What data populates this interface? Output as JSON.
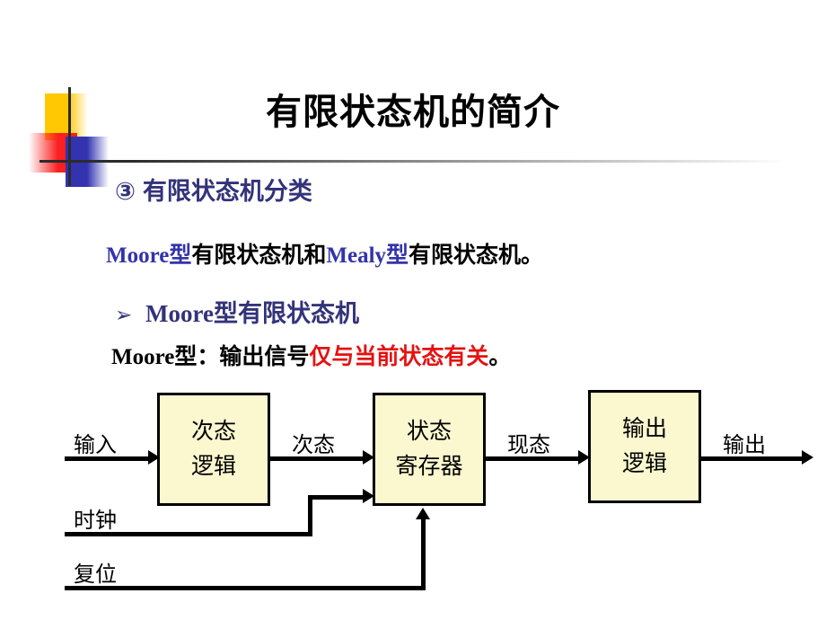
{
  "slide": {
    "title": "有限状态机的简介",
    "section_heading": {
      "marker": "③",
      "text": "有限状态机分类"
    },
    "types_line": {
      "moore": "Moore",
      "moore_suffix": "型",
      "mid": "有限状态机和",
      "mealy": "Mealy",
      "mealy_suffix": "型",
      "tail": "有限状态机。"
    },
    "moore_heading": {
      "bullet": "➢",
      "latin": "Moore",
      "text": "型有限状态机"
    },
    "moore_definition": {
      "latin": "Moore",
      "prefix": "型：输出信号",
      "highlight": "仅与当前状态有关",
      "suffix": "。"
    }
  },
  "diagram": {
    "boxes": [
      {
        "id": "next-logic",
        "line1": "次态",
        "line2": "逻辑"
      },
      {
        "id": "state-reg",
        "line1": "状态",
        "line2": "寄存器"
      },
      {
        "id": "output-logic",
        "line1": "输出",
        "line2": "逻辑"
      }
    ],
    "labels": {
      "input": "输入",
      "next_state": "次态",
      "current_state": "现态",
      "output": "输出",
      "clock": "时钟",
      "reset": "复位"
    }
  },
  "colors": {
    "heading_navy": "#33337a",
    "accent_blue": "#3333aa",
    "accent_red": "#e41212",
    "box_fill": "#FBF8D0",
    "deco_yellow": "#FFC800",
    "deco_red": "#FA2020",
    "deco_blue": "#3333B0"
  }
}
